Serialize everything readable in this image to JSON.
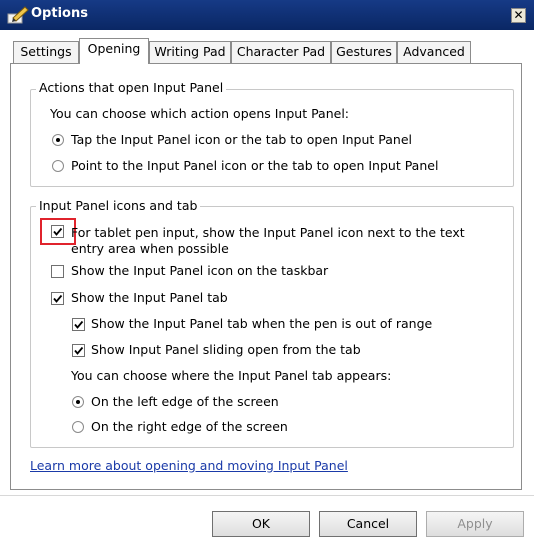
{
  "window": {
    "title": "Options",
    "close_glyph": "✕",
    "icon": "pen-icon"
  },
  "tabs": [
    {
      "label": "Settings",
      "active": false
    },
    {
      "label": "Opening",
      "active": true
    },
    {
      "label": "Writing Pad",
      "active": false
    },
    {
      "label": "Character Pad",
      "active": false
    },
    {
      "label": "Gestures",
      "active": false
    },
    {
      "label": "Advanced",
      "active": false
    }
  ],
  "actions_group": {
    "title": "Actions that open Input Panel",
    "description": "You can choose which action opens Input Panel:",
    "options": [
      {
        "label": "Tap the Input Panel icon or the tab to open Input Panel",
        "selected": true
      },
      {
        "label": "Point to the Input Panel icon or the tab to open Input Panel",
        "selected": false
      }
    ]
  },
  "icons_group": {
    "title": "Input Panel icons and tab",
    "show_icon_next_to_text": {
      "label_line1": "For tablet pen input, show the Input Panel icon next to the text",
      "label_line2": "entry area when possible",
      "checked": true
    },
    "show_icon_taskbar": {
      "label": "Show the Input Panel icon on the taskbar",
      "checked": false
    },
    "show_tab": {
      "label": "Show the Input Panel tab",
      "checked": true
    },
    "show_tab_out_of_range": {
      "label": "Show the Input Panel tab when the pen is out of range",
      "checked": true
    },
    "show_sliding_open": {
      "label": "Show Input Panel sliding open from the tab",
      "checked": true
    },
    "position_description": "You can choose where the Input Panel tab appears:",
    "position_options": [
      {
        "label": "On the left edge of the screen",
        "selected": true
      },
      {
        "label": "On the right edge of the screen",
        "selected": false
      }
    ]
  },
  "learn_more_link": "Learn more about opening and moving Input Panel",
  "buttons": {
    "ok": "OK",
    "cancel": "Cancel",
    "apply": "Apply"
  }
}
